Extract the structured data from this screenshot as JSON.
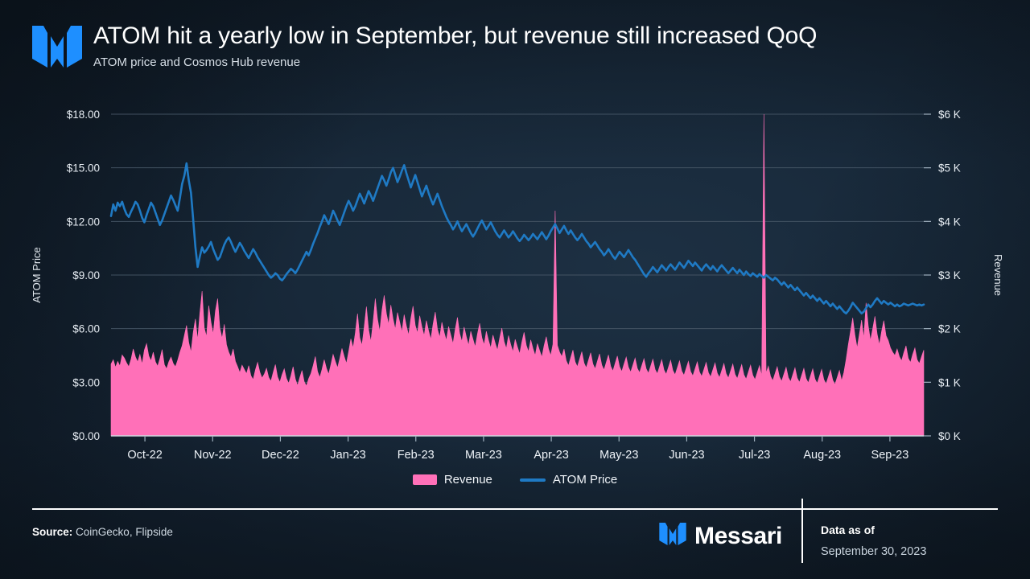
{
  "header": {
    "title": "ATOM hit a yearly low in September, but revenue still increased QoQ",
    "subtitle": "ATOM price and Cosmos Hub revenue",
    "logo_icon": "messari-m-logo-icon"
  },
  "legend": {
    "items": [
      {
        "label": "Revenue",
        "color": "#FF70B8",
        "marker": "area"
      },
      {
        "label": "ATOM Price",
        "color": "#1F7AC4",
        "marker": "line"
      }
    ]
  },
  "footer": {
    "source_label": "Source:",
    "source_value": "CoinGecko, Flipside",
    "brand": "Messari",
    "brand_icon": "messari-m-logo-icon",
    "data_as_of_label": "Data as of",
    "data_as_of_date": "September 30, 2023"
  },
  "colors": {
    "background_dark": "#0d1722",
    "background_light": "#1d3043",
    "revenue_pink": "#FF70B8",
    "price_blue": "#1F7AC4",
    "grid": "#4a5a6a",
    "text": "#FFFFFF"
  },
  "chart_data": {
    "type": "line",
    "title": "ATOM hit a yearly low in September, but revenue still increased QoQ",
    "subtitle": "ATOM price and Cosmos Hub revenue",
    "xlabel": "",
    "ylabel": "ATOM Price",
    "y2label": "Revenue",
    "ylim": [
      0,
      18
    ],
    "y2lim": [
      0,
      6000
    ],
    "yticks": [
      0,
      3,
      6,
      9,
      12,
      15,
      18
    ],
    "ytick_labels": [
      "$0.00",
      "$3.00",
      "$6.00",
      "$9.00",
      "$12.00",
      "$15.00",
      "$18.00"
    ],
    "y2ticks": [
      0,
      1000,
      2000,
      3000,
      4000,
      5000,
      6000
    ],
    "y2tick_labels": [
      "$0 K",
      "$1 K",
      "$2 K",
      "$3 K",
      "$4 K",
      "$5 K",
      "$6 K"
    ],
    "grid": true,
    "legend_position": "bottom",
    "xtick_labels": [
      "Oct-22",
      "Nov-22",
      "Dec-22",
      "Jan-23",
      "Feb-23",
      "Mar-23",
      "Apr-23",
      "May-23",
      "Jun-23",
      "Jul-23",
      "Aug-23",
      "Sep-23"
    ],
    "x_start": "2022-10-01",
    "x_end": "2023-09-30",
    "series": [
      {
        "name": "Revenue",
        "axis": "right",
        "type": "area",
        "color": "#FF70B8",
        "unit": "USD",
        "values": [
          1340,
          1420,
          1280,
          1390,
          1305,
          1510,
          1450,
          1360,
          1290,
          1430,
          1620,
          1470,
          1380,
          1520,
          1340,
          1600,
          1720,
          1490,
          1400,
          1560,
          1380,
          1300,
          1440,
          1610,
          1330,
          1250,
          1380,
          1470,
          1350,
          1290,
          1410,
          1560,
          1680,
          1870,
          2060,
          1740,
          1560,
          1930,
          2180,
          1790,
          2290,
          2700,
          2010,
          1850,
          2430,
          2120,
          1900,
          2330,
          2560,
          2010,
          1820,
          2080,
          1700,
          1560,
          1470,
          1620,
          1390,
          1290,
          1180,
          1320,
          1240,
          1160,
          1310,
          1120,
          1050,
          1230,
          1370,
          1190,
          1080,
          1150,
          1260,
          1090,
          1020,
          1180,
          1330,
          1100,
          1000,
          1140,
          1250,
          1070,
          980,
          1120,
          1290,
          1060,
          940,
          1090,
          1220,
          1010,
          930,
          1070,
          1160,
          1310,
          1480,
          1200,
          1090,
          1240,
          1420,
          1260,
          1150,
          1330,
          1520,
          1390,
          1270,
          1440,
          1630,
          1480,
          1350,
          1570,
          1810,
          1640,
          1920,
          2280,
          1830,
          1690,
          2030,
          2410,
          1980,
          1760,
          2120,
          2560,
          2180,
          1950,
          2340,
          2620,
          2280,
          2080,
          2440,
          2180,
          1990,
          2300,
          2120,
          1940,
          2260,
          2050,
          1880,
          2190,
          2420,
          2060,
          1920,
          2240,
          2030,
          1870,
          2150,
          1960,
          1800,
          2080,
          2310,
          1990,
          1840,
          2120,
          1930,
          1780,
          2040,
          1880,
          1720,
          1990,
          2210,
          1910,
          1760,
          2030,
          1850,
          1690,
          1950,
          1800,
          1660,
          1900,
          2100,
          1830,
          1700,
          1950,
          1780,
          1640,
          1880,
          1730,
          1600,
          1820,
          2010,
          1760,
          1630,
          1870,
          1700,
          1570,
          1800,
          1660,
          1530,
          1750,
          1930,
          1690,
          1570,
          1790,
          1630,
          1500,
          1720,
          1590,
          1470,
          1680,
          1850,
          1620,
          1500,
          1710,
          4200,
          1690,
          1560,
          1480,
          1620,
          1400,
          1310,
          1460,
          1600,
          1380,
          1290,
          1430,
          1570,
          1360,
          1270,
          1410,
          1550,
          1340,
          1250,
          1390,
          1530,
          1320,
          1230,
          1370,
          1510,
          1300,
          1210,
          1350,
          1490,
          1290,
          1200,
          1340,
          1470,
          1280,
          1190,
          1320,
          1450,
          1260,
          1180,
          1310,
          1440,
          1250,
          1170,
          1300,
          1430,
          1240,
          1160,
          1290,
          1420,
          1230,
          1150,
          1280,
          1410,
          1220,
          1140,
          1270,
          1400,
          1210,
          1130,
          1260,
          1390,
          1200,
          1120,
          1250,
          1380,
          1190,
          1110,
          1240,
          1370,
          1180,
          1100,
          1230,
          1360,
          1170,
          1090,
          1220,
          1350,
          1160,
          1080,
          1210,
          1340,
          1150,
          1070,
          1200,
          1330,
          1140,
          1060,
          1190,
          1320,
          1130,
          1050,
          1180,
          1310,
          1120,
          6000,
          1170,
          1300,
          1110,
          1030,
          1160,
          1290,
          1100,
          1020,
          1150,
          1280,
          1090,
          1010,
          1140,
          1270,
          1080,
          1000,
          1130,
          1260,
          1070,
          990,
          1120,
          1250,
          1060,
          980,
          1110,
          1240,
          1050,
          970,
          1100,
          1230,
          1040,
          960,
          1090,
          1220,
          1030,
          1180,
          1420,
          1700,
          1950,
          2200,
          1880,
          1640,
          1900,
          2160,
          1820,
          2480,
          2050,
          1780,
          2000,
          2230,
          1900,
          1700,
          1950,
          2150,
          1870,
          1780,
          1640,
          1560,
          1500,
          1620,
          1480,
          1400,
          1550,
          1680,
          1450,
          1370,
          1520,
          1640,
          1420,
          1350,
          1480,
          1600
        ]
      },
      {
        "name": "ATOM Price",
        "axis": "left",
        "type": "line",
        "color": "#1F7AC4",
        "unit": "USD",
        "values": [
          12.3,
          12.95,
          12.6,
          13.05,
          12.85,
          13.1,
          12.7,
          12.4,
          12.25,
          12.55,
          12.8,
          13.1,
          12.95,
          12.6,
          12.2,
          11.95,
          12.35,
          12.7,
          13.05,
          12.85,
          12.5,
          12.15,
          11.8,
          12.05,
          12.4,
          12.75,
          13.1,
          13.45,
          13.2,
          12.9,
          12.6,
          13.3,
          14.1,
          14.55,
          15.25,
          14.3,
          13.6,
          12.1,
          10.55,
          9.45,
          10.05,
          10.55,
          10.25,
          10.4,
          10.6,
          10.85,
          10.45,
          10.15,
          9.85,
          10.0,
          10.35,
          10.7,
          10.95,
          11.1,
          10.85,
          10.55,
          10.3,
          10.55,
          10.8,
          10.6,
          10.35,
          10.15,
          9.95,
          10.2,
          10.45,
          10.25,
          10.0,
          9.8,
          9.6,
          9.4,
          9.2,
          9.0,
          8.85,
          8.95,
          9.1,
          9.0,
          8.8,
          8.7,
          8.85,
          9.05,
          9.2,
          9.35,
          9.25,
          9.1,
          9.3,
          9.55,
          9.8,
          10.05,
          10.3,
          10.1,
          10.4,
          10.75,
          11.05,
          11.35,
          11.7,
          12.0,
          12.35,
          12.1,
          11.85,
          12.2,
          12.6,
          12.35,
          12.05,
          11.8,
          12.15,
          12.5,
          12.85,
          13.15,
          12.9,
          12.6,
          12.85,
          13.2,
          13.55,
          13.3,
          13.0,
          13.35,
          13.7,
          13.45,
          13.15,
          13.5,
          13.85,
          14.2,
          14.55,
          14.3,
          14.0,
          14.35,
          14.75,
          15.0,
          14.6,
          14.2,
          14.5,
          14.85,
          15.15,
          14.7,
          14.3,
          13.9,
          14.25,
          14.6,
          14.2,
          13.8,
          13.4,
          13.7,
          14.0,
          13.6,
          13.25,
          12.95,
          13.25,
          13.55,
          13.2,
          12.85,
          12.55,
          12.25,
          12.0,
          11.8,
          11.55,
          11.75,
          12.0,
          11.7,
          11.45,
          11.65,
          11.85,
          11.6,
          11.35,
          11.15,
          11.35,
          11.6,
          11.85,
          12.05,
          11.8,
          11.55,
          11.75,
          11.95,
          11.7,
          11.45,
          11.25,
          11.1,
          11.3,
          11.5,
          11.3,
          11.1,
          11.25,
          11.45,
          11.25,
          11.05,
          10.9,
          11.05,
          11.25,
          11.1,
          10.95,
          11.1,
          11.3,
          11.15,
          11.0,
          11.2,
          11.4,
          11.2,
          11.0,
          11.2,
          11.45,
          11.65,
          11.85,
          11.6,
          11.35,
          11.55,
          11.75,
          11.5,
          11.3,
          11.5,
          11.3,
          11.1,
          10.95,
          11.1,
          11.3,
          11.1,
          10.9,
          10.75,
          10.55,
          10.7,
          10.85,
          10.65,
          10.45,
          10.3,
          10.1,
          10.25,
          10.45,
          10.25,
          10.05,
          9.9,
          10.1,
          10.3,
          10.15,
          10.0,
          10.2,
          10.4,
          10.2,
          10.0,
          9.85,
          9.65,
          9.45,
          9.25,
          9.05,
          8.9,
          9.1,
          9.25,
          9.45,
          9.3,
          9.15,
          9.35,
          9.55,
          9.4,
          9.25,
          9.45,
          9.6,
          9.45,
          9.3,
          9.5,
          9.7,
          9.55,
          9.4,
          9.6,
          9.8,
          9.65,
          9.5,
          9.7,
          9.55,
          9.4,
          9.25,
          9.45,
          9.6,
          9.45,
          9.3,
          9.5,
          9.35,
          9.2,
          9.4,
          9.55,
          9.4,
          9.25,
          9.1,
          9.25,
          9.4,
          9.25,
          9.1,
          9.3,
          9.15,
          9.0,
          9.2,
          9.05,
          8.95,
          9.1,
          9.0,
          8.9,
          9.05,
          8.95,
          8.85,
          9.0,
          8.9,
          8.8,
          8.7,
          8.85,
          8.75,
          8.6,
          8.45,
          8.6,
          8.45,
          8.3,
          8.45,
          8.3,
          8.15,
          8.3,
          8.15,
          8.0,
          7.85,
          8.0,
          7.85,
          7.7,
          7.85,
          7.7,
          7.55,
          7.7,
          7.55,
          7.4,
          7.55,
          7.4,
          7.25,
          7.4,
          7.25,
          7.1,
          7.25,
          7.1,
          6.95,
          6.85,
          7.0,
          7.2,
          7.45,
          7.3,
          7.15,
          7.0,
          6.85,
          6.95,
          7.15,
          7.35,
          7.2,
          7.35,
          7.55,
          7.7,
          7.55,
          7.4,
          7.55,
          7.45,
          7.35,
          7.45,
          7.35,
          7.25,
          7.35,
          7.25,
          7.3,
          7.4,
          7.35,
          7.3,
          7.35,
          7.4,
          7.35,
          7.3,
          7.35,
          7.3,
          7.35
        ]
      }
    ]
  }
}
